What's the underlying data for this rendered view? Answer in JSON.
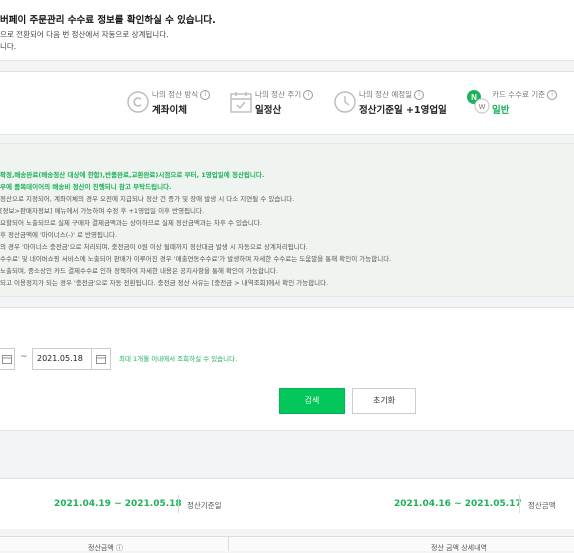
{
  "notice": {
    "line1": "버페이 주문관리 수수료 정보를 확인하실 수 있습니다.",
    "line2": "으로 전환되어 다음 번 정산에서 자동으로 상계됩니다.",
    "line3": "니다."
  },
  "summary": [
    {
      "icon": "copyright-circle-icon",
      "label": "나의 정산 방식",
      "value": "계좌이체",
      "green": false
    },
    {
      "icon": "calendar-icon",
      "label": "나의 정산 주기",
      "value": "일정산",
      "green": false
    },
    {
      "icon": "clock-icon",
      "label": "나의 정산 예정일",
      "value": "정산기준일 +1영업일",
      "green": false
    },
    {
      "icon": "naver-pay-card-icon",
      "label": "카드 수수료 기준",
      "value": "일반",
      "green": true
    }
  ],
  "guide": {
    "lines": [
      "확정,배송완료(배송정산 대상에 한함),반품완료,교환완료)시점으로 부터, 1영업일에 정산됩니다.",
      "우에 품목데이어의 배송비 정산이 진행되니 참고 부탁드립니다.",
      "정산으로 지정되어, 계좌이체의 경우 오전에 지급되나 정산 건 증가 및 장애 발생 시 다소 지연될 수 있습니다.",
      "[정보>판매자정보] 메뉴에서 가능하며 수정 후 +1영업일 이후 반영됩니다.",
      "요할되어 노출되므로 실제 구매자 결제금액과는 상이하므로 실제 정산금액과는 차후 수 있습니다.",
      "후 정산금액에 '마이너스(-)' 로 반영됩니다.",
      "의 경우 '마이너스 충전금'으로 처리되며, 충전금이 0원 이상 될때까지 정산대금 발생 시 자동으로 상계처리됩니다.",
      "수수료' 및 네이버쇼핑 서비스에 노출되어 판매가 이루어진 경우 '매출연동수수료'가 발생하며 자세한 수수료는 도움말을 통해 확인이 가능합니다.",
      "노출되며, 중소상인 카드 결제수수료 인하 정책하여 자세한 내용은 공지사항을 통해 확인이 가능합니다.",
      "되고 이용정지가 되는 경우 '충전금'으로 자동 전환됩니다. 충전금 정산 사유는 [충전금 > 내역조회]에서 확인 가능합니다."
    ]
  },
  "search": {
    "date_separator": "~",
    "end_date": "2021.05.18",
    "hint": "최대 1개월 이내에서 조회하실 수 있습니다.",
    "search_button": "검색",
    "reset_button": "초기화"
  },
  "results": {
    "left_range": "2021.04.19 ~ 2021.05.18",
    "left_label": "정산기준일",
    "right_range": "2021.04.16 ~ 2021.05.17",
    "right_label": "정산금액"
  },
  "table": {
    "col1": "정산금액 ⓘ",
    "col2": "정산 금액 상세내역"
  },
  "colors": {
    "accent_green": "#03c75a",
    "text_green": "#1db15a"
  }
}
